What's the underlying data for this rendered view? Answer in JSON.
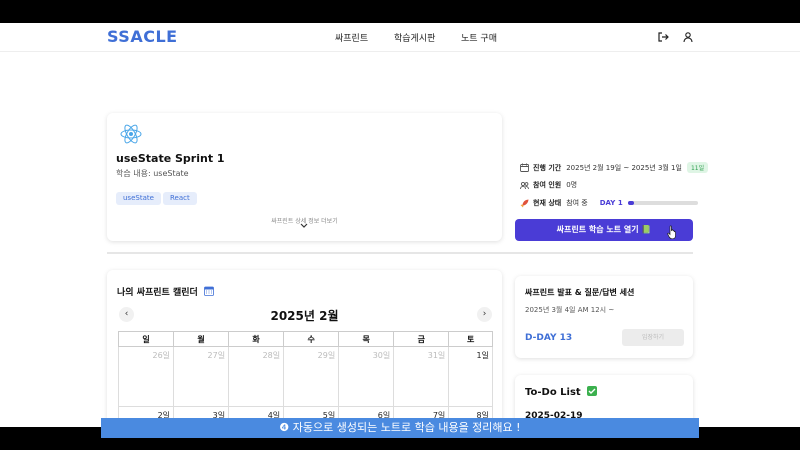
{
  "header": {
    "logo": "SSACLE",
    "nav": [
      "싸프린트",
      "학습게시판",
      "노트 구매"
    ]
  },
  "sprint": {
    "title": "useState Sprint 1",
    "subtitle": "학습 내용: useState",
    "tags": [
      "useState",
      "React"
    ],
    "more": "싸프린트 상세 정보 더보기"
  },
  "info": {
    "period_label": "진행 기간",
    "period_value": "2025년 2월 19일 ~ 2025년 3월 1일",
    "period_badge": "11일",
    "members_label": "참여 인원",
    "members_value": "0명",
    "status_label": "현재 상태",
    "status_value": "참여 중",
    "day_label": "DAY 1",
    "progress": 0.09
  },
  "open_button": "싸프린트 학습 노트 열기 📗",
  "calendar": {
    "title": "나의 싸프린트 캘린더",
    "month": "2025년 2월",
    "weekdays": [
      "일",
      "월",
      "화",
      "수",
      "목",
      "금",
      "토"
    ],
    "week1": [
      "26일",
      "27일",
      "28일",
      "29일",
      "30일",
      "31일",
      "1일"
    ],
    "week2": [
      "2일",
      "3일",
      "4일",
      "5일",
      "6일",
      "7일",
      "8일"
    ]
  },
  "session": {
    "title": "싸프린트 발표 & 질문/답변 세션",
    "date": "2025년 3월 4일 AM 12시 ~",
    "dday": "D-DAY 13",
    "join": "입장하기"
  },
  "todo": {
    "title": "To-Do List",
    "date": "2025-02-19"
  },
  "caption": "❹ 자동으로 생성되는 노트로 학습 내용을 정리해요 !",
  "colors": {
    "primary": "#4a3cd6",
    "brand": "#3f6fd6",
    "caption_bg": "#4a8ae0"
  }
}
